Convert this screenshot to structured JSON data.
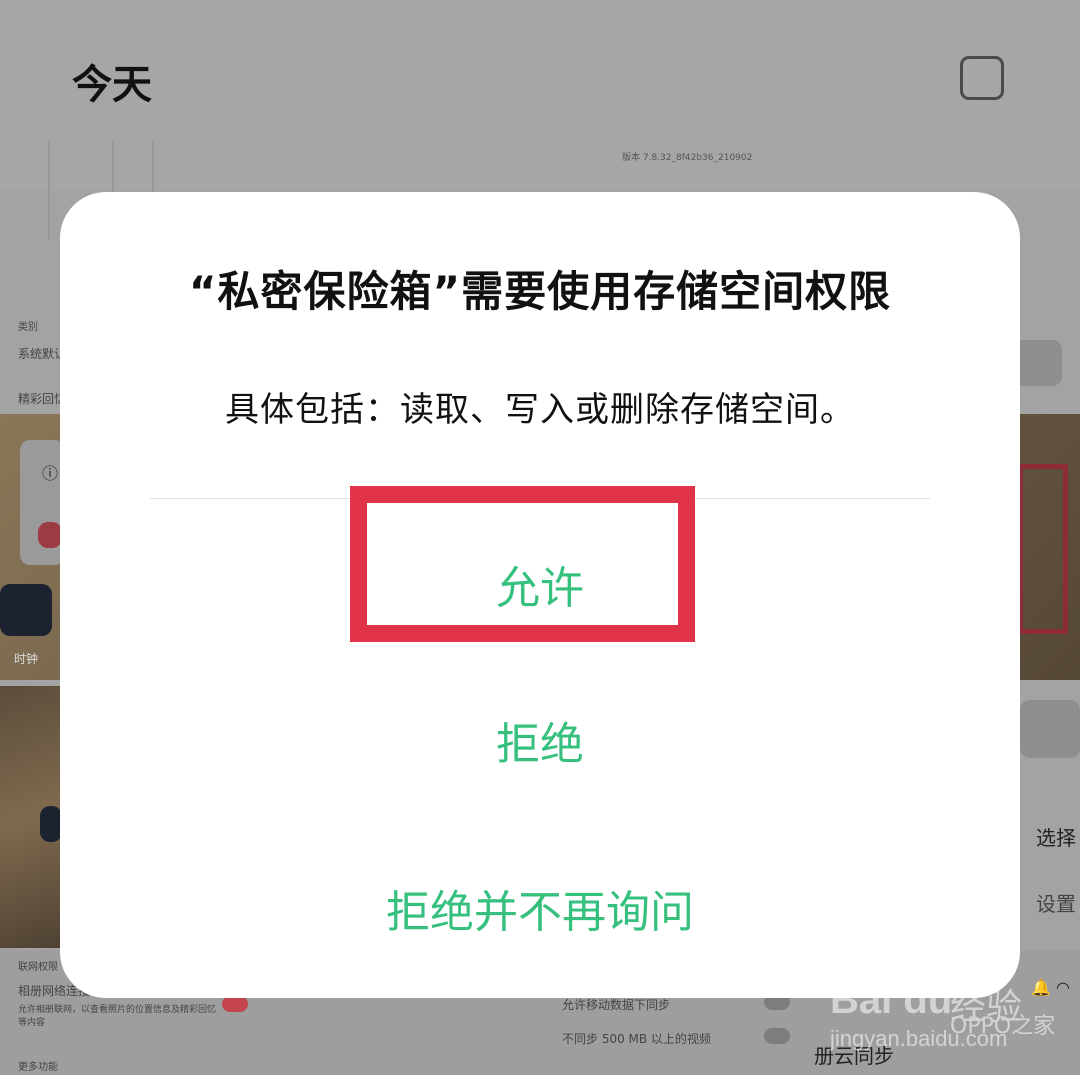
{
  "background": {
    "title": "今天",
    "version": "版本 7.8.32_8f42b36_210902",
    "labels": {
      "category": "类别",
      "system_default": "系统默认",
      "highlights": "精彩回忆",
      "clock": "时钟",
      "network_permission": "联网权限",
      "album_network": "相册网络连接",
      "album_network_desc": "允许相册联网，以查看照片的位置信息及精彩回忆等内容",
      "more_features": "更多功能",
      "sync_mobile_data": "允许移动数据下同步",
      "no_sync_large_video": "不同步 500 MB 以上的视频",
      "cloud_sync": "册云同步",
      "right_select": "选择",
      "right_settings": "设置"
    }
  },
  "dialog": {
    "title": "“私密保险箱”需要使用存储空间权限",
    "description": "具体包括：读取、写入或删除存储空间。",
    "allow_label": "允许",
    "deny_label": "拒绝",
    "deny_forever_label": "拒绝并不再询问"
  },
  "watermark": {
    "brand": "Bai du",
    "jingyan": "经验",
    "url": "jingyan.baidu.com",
    "oppo": "OPPO之家"
  },
  "colors": {
    "accent_green": "#35c07e",
    "highlight_red": "#e23448",
    "dialog_bg": "#ffffff"
  }
}
